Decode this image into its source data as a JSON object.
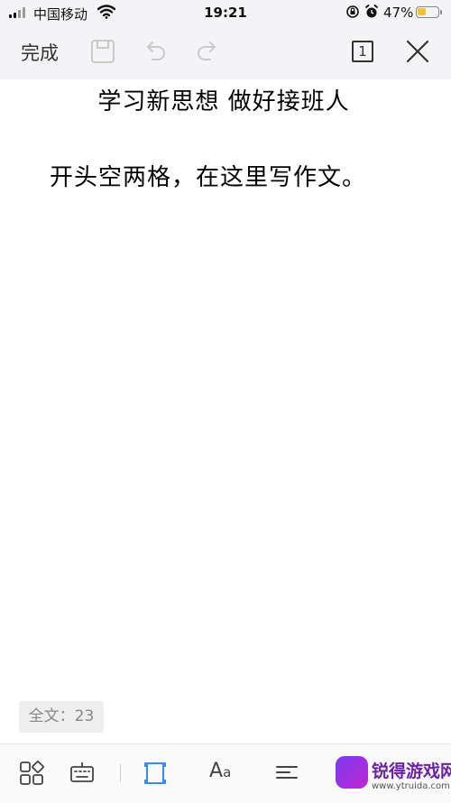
{
  "status_bar": {
    "carrier": "中国移动",
    "time": "19:21",
    "battery_percent": "47%",
    "battery_level": 0.47,
    "battery_color": "#f2c230"
  },
  "toolbar": {
    "done_label": "完成",
    "page_indicator": "1",
    "icons": [
      "save-icon",
      "undo-icon",
      "redo-icon",
      "page-count-icon",
      "close-icon"
    ]
  },
  "document": {
    "title": "学习新思想  做好接班人",
    "paragraph": "开头空两格，在这里写作文。"
  },
  "word_count": {
    "label": "全文：23"
  },
  "bottom_bar": {
    "icons": [
      "apps-grid-icon",
      "keyboard-icon",
      "page-frame-icon",
      "font-icon",
      "align-icon",
      "more-icon"
    ],
    "font_label_big": "A",
    "font_label_small": "a",
    "active_color": "#3a8de0"
  },
  "watermark": {
    "name": "锐得游戏网",
    "url": "www.ytruida.com"
  }
}
